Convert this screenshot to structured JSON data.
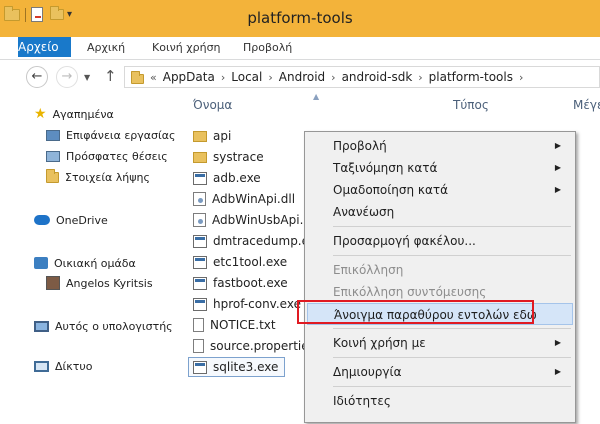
{
  "window": {
    "title": "platform-tools"
  },
  "ribbon": {
    "tabs": [
      {
        "label": "Αρχείο"
      },
      {
        "label": "Αρχική"
      },
      {
        "label": "Κοινή χρήση"
      },
      {
        "label": "Προβολή"
      }
    ]
  },
  "address": {
    "prefix": "«",
    "crumbs": [
      "AppData",
      "Local",
      "Android",
      "android-sdk",
      "platform-tools"
    ],
    "separator": "›"
  },
  "navpane": {
    "favorites_label": "Αγαπημένα",
    "favorites": [
      "Επιφάνεια εργασίας",
      "Πρόσφατες θέσεις",
      "Στοιχεία λήψης"
    ],
    "onedrive": "OneDrive",
    "homegroup": "Οικιακή ομάδα",
    "user": "Angelos Kyritsis",
    "computer": "Αυτός ο υπολογιστής",
    "network": "Δίκτυο"
  },
  "filelist": {
    "columns": {
      "name": "Όνομα",
      "type": "Τύπος",
      "size": "Μέγε"
    },
    "files": [
      {
        "name": "api",
        "kind": "folder"
      },
      {
        "name": "systrace",
        "kind": "folder"
      },
      {
        "name": "adb.exe",
        "kind": "exe"
      },
      {
        "name": "AdbWinApi.dll",
        "kind": "dll"
      },
      {
        "name": "AdbWinUsbApi.dll",
        "kind": "dll"
      },
      {
        "name": "dmtracedump.exe",
        "kind": "exe"
      },
      {
        "name": "etc1tool.exe",
        "kind": "exe"
      },
      {
        "name": "fastboot.exe",
        "kind": "exe"
      },
      {
        "name": "hprof-conv.exe",
        "kind": "exe"
      },
      {
        "name": "NOTICE.txt",
        "kind": "txt"
      },
      {
        "name": "source.properties",
        "kind": "txt"
      },
      {
        "name": "sqlite3.exe",
        "kind": "exe"
      }
    ]
  },
  "context_menu": {
    "items": [
      {
        "label": "Προβολή",
        "submenu": true
      },
      {
        "label": "Ταξινόμηση κατά",
        "submenu": true
      },
      {
        "label": "Ομαδοποίηση κατά",
        "submenu": true
      },
      {
        "label": "Ανανέωση"
      },
      {
        "label": "Προσαρμογή φακέλου..."
      },
      {
        "label": "Επικόλληση",
        "disabled": true
      },
      {
        "label": "Επικόλληση συντόμευσης",
        "disabled": true
      },
      {
        "label": "Άνοιγμα παραθύρου εντολών εδώ",
        "highlighted": true
      },
      {
        "label": "Κοινή χρήση με",
        "submenu": true
      },
      {
        "label": "Δημιουργία",
        "submenu": true
      },
      {
        "label": "Ιδιότητες"
      }
    ]
  }
}
